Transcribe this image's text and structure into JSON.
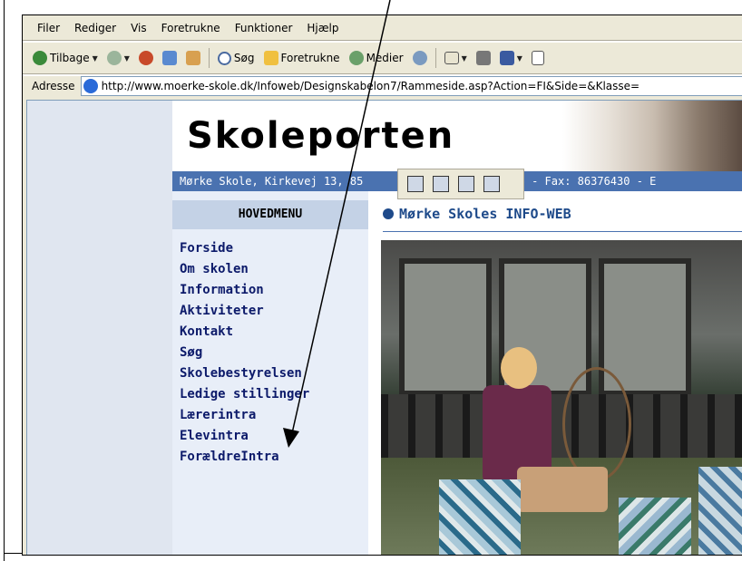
{
  "menubar": {
    "items": [
      "Filer",
      "Rediger",
      "Vis",
      "Foretrukne",
      "Funktioner",
      "Hjælp"
    ]
  },
  "toolbar": {
    "back_label": "Tilbage",
    "search_label": "Søg",
    "favorites_label": "Foretrukne",
    "media_label": "Medier"
  },
  "address": {
    "label": "Adresse",
    "url": "http://www.moerke-skole.dk/Infoweb/Designskabelon7/Rammeside.asp?Action=FI&Side=&Klasse="
  },
  "site": {
    "logo": "Skoleporten",
    "info_bar": "Mørke Skole, Kirkevej 13, 85",
    "info_bar_right": "6377466 - Fax: 86376430 - E",
    "menu_heading": "HOVEDMENU",
    "page_title": "Mørke Skoles INFO-WEB",
    "nav": [
      "Forside",
      "Om skolen",
      "Information",
      "Aktiviteter",
      "Kontakt",
      "Søg",
      "Skolebestyrelsen",
      "Ledige stillinger",
      "Lærerintra",
      "Elevintra",
      "ForældreIntra"
    ]
  },
  "colors": {
    "info_bar": "#4a72b0",
    "nav_text": "#0c1a6a",
    "title": "#1e4a8a"
  }
}
